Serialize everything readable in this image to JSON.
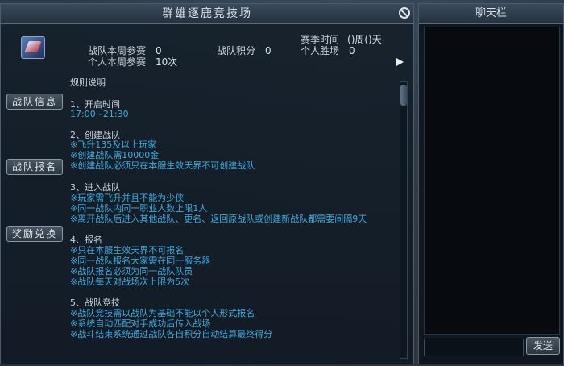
{
  "arena": {
    "title": "群雄逐鹿竞技场",
    "season_time_label": "赛季时间",
    "season_time_value": "()周()天",
    "team_weekly_label": "战队本周参赛",
    "team_weekly_value": "0",
    "team_points_label": "战队积分",
    "team_points_value": "0",
    "personal_wins_label": "个人胜场",
    "personal_wins_value": "0",
    "personal_weekly_label": "个人本周参赛",
    "personal_weekly_value": "10次"
  },
  "side_buttons": {
    "team_info": "战队信息",
    "team_signup": "战队报名",
    "reward_exchange": "奖励兑换"
  },
  "rules": {
    "title": "规则说明",
    "s1_title": "1、开启时间",
    "s1_time": "17:00~21:30",
    "s2_title": "2、创建战队",
    "s2_items": [
      "※飞升135及以上玩家",
      "※创建战队需10000金",
      "※创建战队必须只在本服生效天界不可创建战队"
    ],
    "s3_title": "3、进入战队",
    "s3_items": [
      "※玩家需飞升并且不能为少侠",
      "※同一战队内同一职业人数上限1人",
      "※离开战队后进入其他战队、更名、返回原战队或创建新战队都需要间隔9天"
    ],
    "s4_title": "4、报名",
    "s4_items": [
      "※只在本服生效天界不可报名",
      "※同一战队报名大家需在同一服务器",
      "※战队报名必须为同一战队队员",
      "※战队每天对战场次上限为5次"
    ],
    "s5_title": "5、战队竞技",
    "s5_items": [
      "※战队竞技需以战队为基础不能以个人形式报名",
      "※系统自动匹配对手成功后传入战场",
      "※战斗结束系统通过战队各自积分自动结算最终得分"
    ]
  },
  "chat": {
    "title": "聊天栏",
    "send_label": "发送"
  }
}
